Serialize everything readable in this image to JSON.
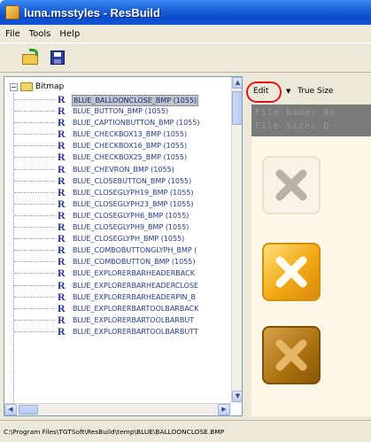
{
  "window": {
    "title": "luna.msstyles - ResBuild"
  },
  "menubar": {
    "items": [
      "File",
      "Tools",
      "Help"
    ]
  },
  "toolbar": {
    "open_icon": "open-folder-icon",
    "save_icon": "save-disk-icon"
  },
  "tree": {
    "root_label": "Bitmap",
    "expander": "−",
    "items": [
      "BLUE_BALLOONCLOSE_BMP (1055)",
      "BLUE_BUTTON_BMP (1055)",
      "BLUE_CAPTIONBUTTON_BMP (1055)",
      "BLUE_CHECKBOX13_BMP (1055)",
      "BLUE_CHECKBOX16_BMP (1055)",
      "BLUE_CHECKBOX25_BMP (1055)",
      "BLUE_CHEVRON_BMP (1055)",
      "BLUE_CLOSEBUTTON_BMP (1055)",
      "BLUE_CLOSEGLYPH19_BMP (1055)",
      "BLUE_CLOSEGLYPH23_BMP (1055)",
      "BLUE_CLOSEGLYPH6_BMP (1055)",
      "BLUE_CLOSEGLYPH9_BMP (1055)",
      "BLUE_CLOSEGLYPH_BMP (1055)",
      "BLUE_COMBOBUTTONGLYPH_BMP (",
      "BLUE_COMBOBUTTON_BMP (1055)",
      "BLUE_EXPLORERBARHEADERBACK",
      "BLUE_EXPLORERBARHEADERCLOSE",
      "BLUE_EXPLORERBARHEADERPIN_B",
      "BLUE_EXPLORERBARTOOLBARBACK",
      "BLUE_EXPLORERBARTOOLBARBUT",
      "BLUE_EXPLORERBARTOOLBARBUTT"
    ],
    "selected_index": 0,
    "scroll_up": "▲",
    "scroll_down": "▼",
    "scroll_left": "◀",
    "scroll_right": "▶"
  },
  "preview": {
    "edit_label": "Edit",
    "dropdown_glyph": "▼",
    "true_size_label": "True Size",
    "file_name_line": "File Name: Ra",
    "file_size_line": "File Size: D",
    "tiles": [
      "close-normal-icon",
      "close-hot-icon",
      "close-pressed-icon"
    ],
    "colors": {
      "hot": "#f2a812",
      "pressed": "#a9700e",
      "highlight_ring": "#e0141c"
    }
  },
  "status": {
    "path": "C:\\Program Files\\TGTSoft\\ResBuild\\temp\\BLUE\\BALLOONCLOSE.BMP"
  }
}
